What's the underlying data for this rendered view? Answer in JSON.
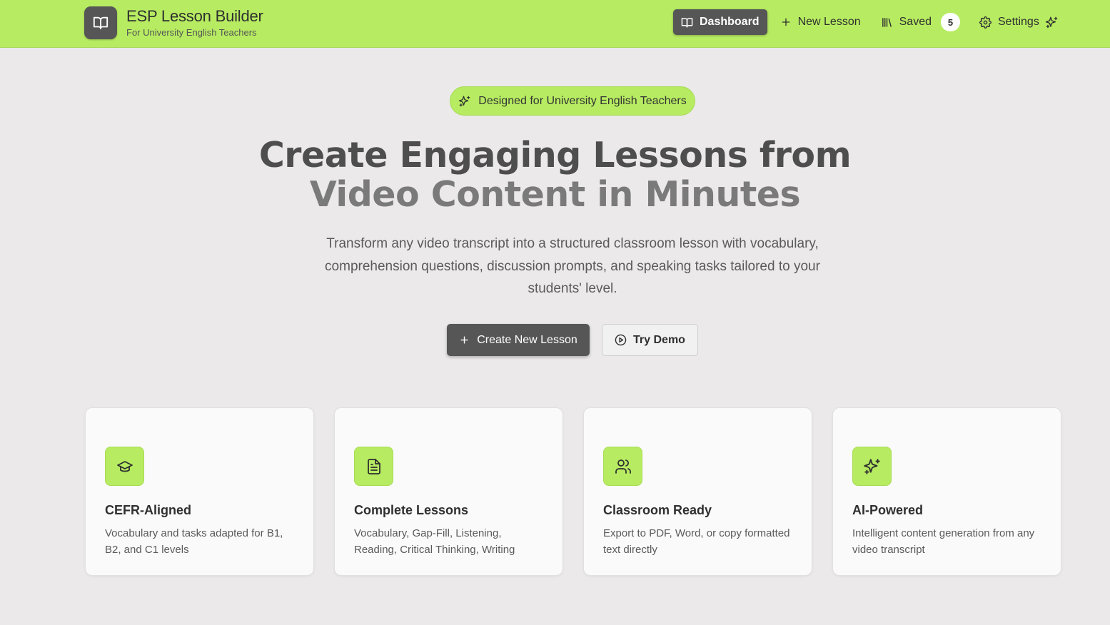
{
  "app": {
    "title": "ESP Lesson Builder",
    "subtitle": "For University English Teachers",
    "logo_icon": "book-open-icon"
  },
  "nav": {
    "dashboard": "Dashboard",
    "new_lesson": "New Lesson",
    "saved": "Saved",
    "saved_count": "5",
    "settings": "Settings"
  },
  "hero": {
    "pill": "Designed for University English Teachers",
    "title_line1": "Create Engaging Lessons from",
    "title_line2": "Video Content in Minutes",
    "subtitle": "Transform any video transcript into a structured classroom lesson with vocabulary, comprehension questions, discussion prompts, and speaking tasks tailored to your students' level.",
    "primary_cta": "Create New Lesson",
    "secondary_cta": "Try Demo"
  },
  "features": [
    {
      "title": "CEFR-Aligned",
      "desc": "Vocabulary and tasks adapted for B1, B2, and C1 levels",
      "icon": "graduation-cap-icon"
    },
    {
      "title": "Complete Lessons",
      "desc": "Vocabulary, Gap-Fill, Listening, Reading, Critical Thinking, Writing",
      "icon": "document-icon"
    },
    {
      "title": "Classroom Ready",
      "desc": "Export to PDF, Word, or copy formatted text directly",
      "icon": "users-icon"
    },
    {
      "title": "AI-Powered",
      "desc": "Intelligent content generation from any video transcript",
      "icon": "sparkles-icon"
    }
  ],
  "colors": {
    "accent": "#b7ec62",
    "dark": "#565656",
    "background": "#ebe9e9",
    "card": "#fafafa"
  }
}
